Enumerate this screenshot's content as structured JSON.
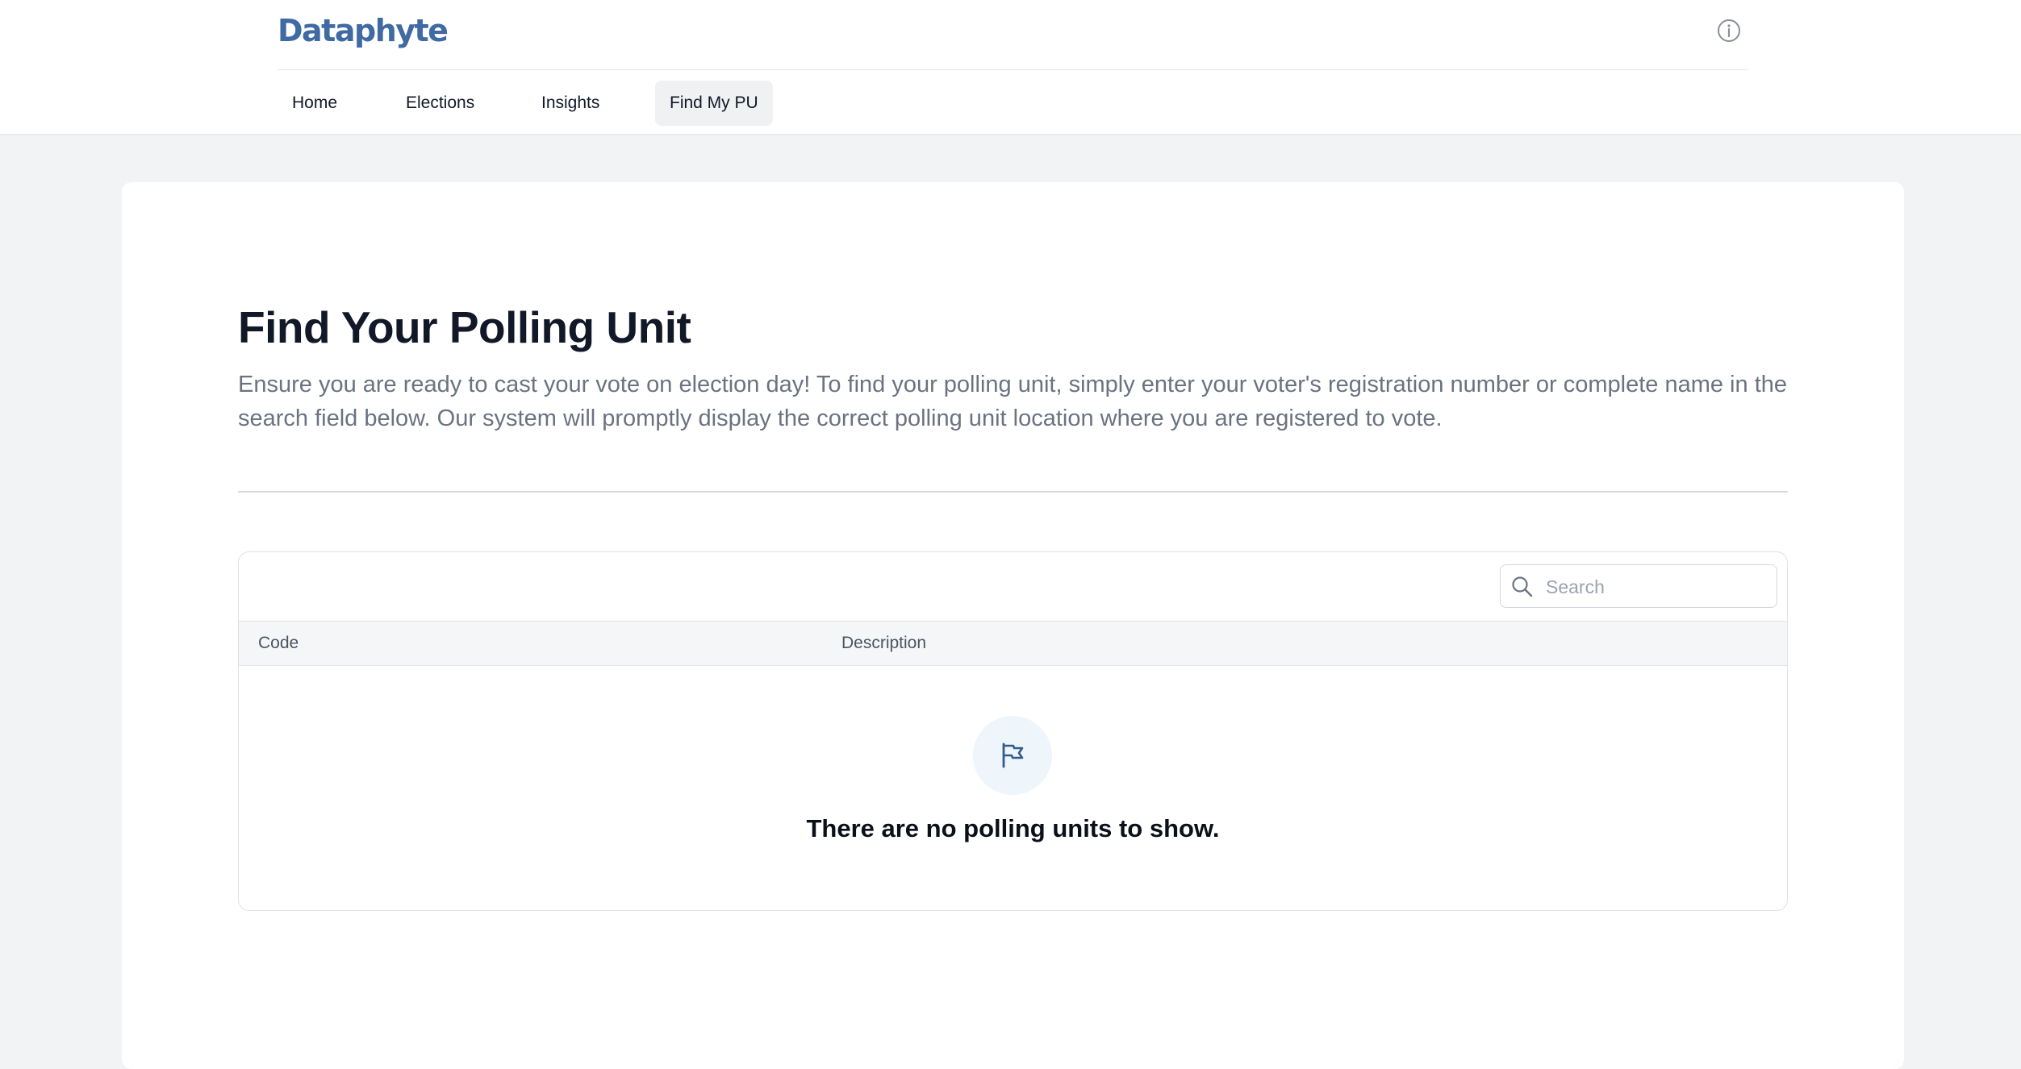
{
  "header": {
    "logo_text": "Dataphyte",
    "info_icon": "info-circle-icon"
  },
  "nav": {
    "items": [
      {
        "label": "Home"
      },
      {
        "label": "Elections"
      },
      {
        "label": "Insights"
      },
      {
        "label": "Find My PU",
        "active": true
      }
    ]
  },
  "main": {
    "title": "Find Your Polling Unit",
    "description": "Ensure you are ready to cast your vote on election day! To find your polling unit, simply enter your voter's registration number or complete name in the search field below. Our system will promptly display the correct polling unit location where you are registered to vote.",
    "search": {
      "placeholder": "Search",
      "value": "",
      "icon": "search-icon"
    },
    "table": {
      "columns": [
        "Code",
        "Description"
      ],
      "rows": [],
      "empty_icon": "flag-icon",
      "empty_message": "There are no polling units to show."
    }
  },
  "colors": {
    "brand": "#3f6aa3",
    "page_background": "#f2f3f5",
    "active_nav_background": "#f0f1f3",
    "empty_icon_background": "#eef5fb"
  }
}
